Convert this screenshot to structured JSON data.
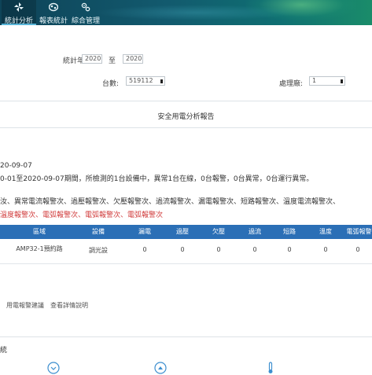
{
  "nav": {
    "items": [
      {
        "label": "統計分析",
        "icon": "pinwheel-icon"
      },
      {
        "label": "報表統計",
        "icon": "chart-icon"
      },
      {
        "label": "綜合管理",
        "icon": "gears-icon"
      }
    ]
  },
  "filters": {
    "year_label": "統計年份",
    "year_from": "2020",
    "to_label": "至",
    "year_to": "2020",
    "count_label": "台數:",
    "count_value": "519112",
    "processor_label": "處理廠:",
    "processor_value": "1"
  },
  "report": {
    "title": "安全用電分析報告",
    "date_line": "20-09-07",
    "summary_line": "0-01至2020-09-07期間，所檢測的1台設備中，異常1台在線，0台報警，0台異常，0台運行異常。",
    "types_line": "汝、異常電流報警次、過壓報警次、欠壓報警次、過流報警次、漏電報警次、短路報警次、溫度電流報警次、",
    "alert_line": "溫度報警次、電弧報警次、電弧報警次、電弧報警次"
  },
  "table": {
    "headers": [
      "區域",
      "設備",
      "漏電",
      "過壓",
      "欠壓",
      "過流",
      "短路",
      "溫度",
      "電弧報警"
    ],
    "rows": [
      {
        "area": "AMP32-1預約路",
        "device": "調光設",
        "values": [
          "0",
          "0",
          "0",
          "0",
          "0",
          "0",
          "0"
        ]
      }
    ]
  },
  "links": {
    "left": "用電報警建議",
    "right": "查看詳情說明"
  },
  "section": {
    "label": "統"
  },
  "colors": {
    "nav_bg": "#125a6e",
    "table_header": "#2b6fb6",
    "alert_red": "#d03a3a"
  }
}
